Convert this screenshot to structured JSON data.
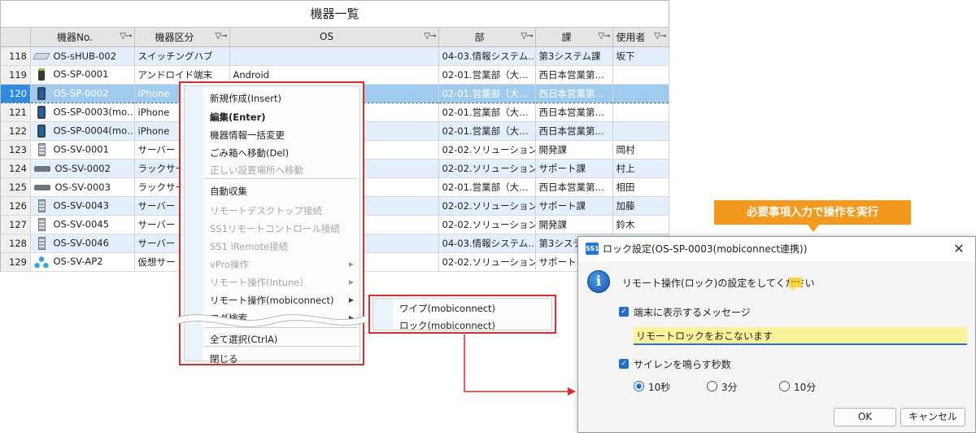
{
  "grid": {
    "title": "機器一覧",
    "headers": [
      "",
      "機器No.",
      "機器区分",
      "OS",
      "部",
      "課",
      "使用者"
    ],
    "rows": [
      {
        "num": "118",
        "icon": "hub-icon",
        "device_no": "OS-sHUB-002",
        "category": "スイッチングハブ",
        "os": "",
        "dept": "04-03.情報システム…",
        "section": "第3システム課",
        "user": "坂下"
      },
      {
        "num": "119",
        "icon": "android-icon",
        "device_no": "OS-SP-0001",
        "category": "アンドロイド端末",
        "os": "Android",
        "dept": "02-01.営業部（大…",
        "section": "西日本営業第…",
        "user": ""
      },
      {
        "num": "120",
        "icon": "smartphone-icon",
        "device_no": "OS-SP-0002",
        "category": "iPhone",
        "os": "",
        "dept": "02-01.営業部（大…",
        "section": "西日本営業第…",
        "user": ""
      },
      {
        "num": "121",
        "icon": "smartphone-icon",
        "device_no": "OS-SP-0003(mo…",
        "category": "iPhone",
        "os": "",
        "dept": "02-01.営業部（大…",
        "section": "西日本営業第…",
        "user": ""
      },
      {
        "num": "122",
        "icon": "smartphone-icon",
        "device_no": "OS-SP-0004(mo…",
        "category": "iPhone",
        "os": "",
        "dept": "02-01.営業部（大…",
        "section": "西日本営業第…",
        "user": ""
      },
      {
        "num": "123",
        "icon": "server-icon",
        "device_no": "OS-SV-0001",
        "category": "サーバー",
        "os": "d",
        "dept": "02-02.ソリューション…",
        "section": "開発課",
        "user": "岡村"
      },
      {
        "num": "124",
        "icon": "rack-server-icon",
        "device_no": "OS-SV-0002",
        "category": "ラックサー",
        "os": "d Edition",
        "dept": "02-02.ソリューション…",
        "section": "サポート課",
        "user": "村上"
      },
      {
        "num": "125",
        "icon": "rack-server-icon",
        "device_no": "OS-SV-0003",
        "category": "ラックサー",
        "os": "dard",
        "dept": "02-01.営業部（大…",
        "section": "西日本営業第…",
        "user": "相田"
      },
      {
        "num": "126",
        "icon": "server-icon",
        "device_no": "OS-SV-0043",
        "category": "サーバー",
        "os": "d Edition",
        "dept": "02-02.ソリューション…",
        "section": "サポート課",
        "user": "加藤"
      },
      {
        "num": "127",
        "icon": "server-icon",
        "device_no": "OS-SV-0045",
        "category": "サーバー",
        "os": "d Edition",
        "dept": "02-02.ソリューション…",
        "section": "開発課",
        "user": "鈴木"
      },
      {
        "num": "128",
        "icon": "server-icon",
        "device_no": "OS-SV-0046",
        "category": "サーバー",
        "os": "d Edition",
        "dept": "04-03.情報システム…",
        "section": "第3システム",
        "user": ""
      },
      {
        "num": "129",
        "icon": "network-icon",
        "device_no": "OS-SV-AP2",
        "category": "仮想サー",
        "os": "d",
        "dept": "02-02.ソリューション…",
        "section": "サポート",
        "user": ""
      }
    ]
  },
  "context_menu": {
    "items": [
      {
        "label": "新規作成(Insert)",
        "disabled": false,
        "bold": false,
        "submenu": false
      },
      {
        "label": "編集(Enter)",
        "disabled": false,
        "bold": true,
        "submenu": false
      },
      {
        "label": "機器情報一括変更",
        "disabled": false,
        "bold": false,
        "submenu": false
      },
      {
        "label": "ごみ箱へ移動(Del)",
        "disabled": false,
        "bold": false,
        "submenu": false
      },
      {
        "label": "正しい設置場所へ移動",
        "disabled": true,
        "bold": false,
        "submenu": false
      },
      {
        "label": "自動収集",
        "disabled": false,
        "bold": false,
        "submenu": false
      },
      {
        "label": "リモートデスクトップ接続",
        "disabled": true,
        "bold": false,
        "submenu": false
      },
      {
        "label": "SS1リモートコントロール接続",
        "disabled": true,
        "bold": false,
        "submenu": false
      },
      {
        "label": "SS1 iRemote接続",
        "disabled": true,
        "bold": false,
        "submenu": false
      },
      {
        "label": "vPro操作",
        "disabled": true,
        "bold": false,
        "submenu": true
      },
      {
        "label": "リモート操作(Intune)",
        "disabled": true,
        "bold": false,
        "submenu": true
      },
      {
        "label": "リモート操作(mobiconnect)",
        "disabled": false,
        "bold": false,
        "submenu": true
      },
      {
        "label": "ログ検索",
        "disabled": false,
        "bold": false,
        "submenu": true
      },
      {
        "label": "全て選択(CtrlA)",
        "disabled": false,
        "bold": false,
        "submenu": false
      },
      {
        "label": "閉じる",
        "disabled": false,
        "bold": false,
        "submenu": false
      }
    ]
  },
  "submenu": {
    "items": [
      "ワイプ(mobiconnect)",
      "ロック(mobiconnect)"
    ]
  },
  "callout": {
    "text": "必要事項入力で操作を実行",
    "color": "#f39a1e"
  },
  "dialog": {
    "app_icon_text": "SS1",
    "title": "ロック設定(OS-SP-0003(mobiconnect連携))",
    "message": "リモート操作(ロック)の設定をしてください",
    "show_message_label": "端末に表示するメッセージ",
    "show_message_checked": true,
    "message_value": "リモートロックをおこないます",
    "siren_label": "サイレンを鳴らす秒数",
    "siren_checked": true,
    "siren_options": [
      "10秒",
      "3分",
      "10分"
    ],
    "siren_selected": "10秒",
    "ok_label": "OK",
    "cancel_label": "キャンセル",
    "close_glyph": "✕"
  },
  "colors": {
    "highlight_border": "#e22a2a",
    "selected_row": "#9fcbee",
    "alt_row": "#e3f0fb",
    "accent_blue": "#1f6fd1"
  }
}
